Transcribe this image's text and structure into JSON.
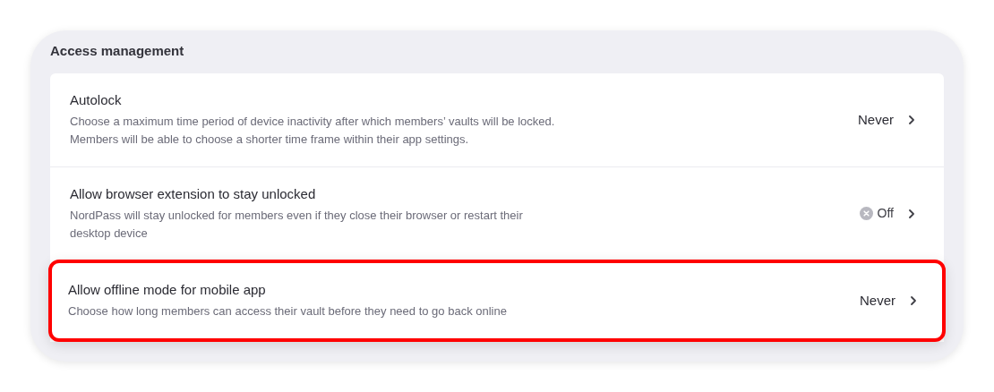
{
  "section": {
    "title": "Access management"
  },
  "settings": [
    {
      "title": "Autolock",
      "description": [
        "Choose a maximum time period of device inactivity after which members’ vaults will be locked.",
        "Members will be able to choose a shorter time frame within their app settings."
      ],
      "value": "Never",
      "kind": "text",
      "highlighted": false
    },
    {
      "title": "Allow browser extension to stay unlocked",
      "description": [
        "NordPass will stay unlocked for members even if they close their browser or restart their",
        "desktop device"
      ],
      "value": "Off",
      "kind": "status",
      "highlighted": false
    },
    {
      "title": "Allow offline mode for mobile app",
      "description": [
        "Choose how long members can access their vault before they need to go back online"
      ],
      "value": "Never",
      "kind": "text",
      "highlighted": true
    }
  ]
}
